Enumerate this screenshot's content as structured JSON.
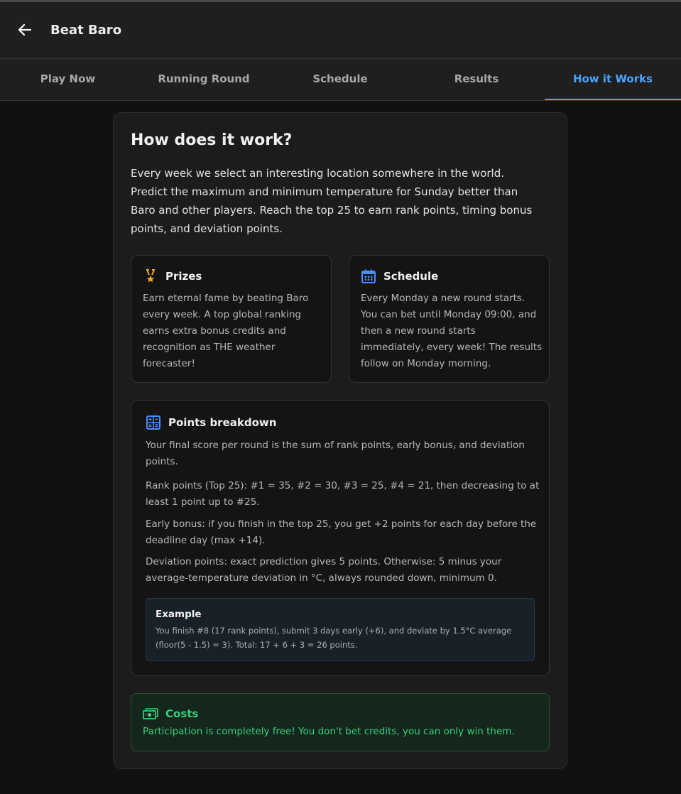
{
  "header": {
    "title": "Beat Baro",
    "back_icon": "arrow-left-icon"
  },
  "tabs": [
    {
      "label": "Play Now",
      "active": false
    },
    {
      "label": "Running Round",
      "active": false
    },
    {
      "label": "Schedule",
      "active": false
    },
    {
      "label": "Results",
      "active": false
    },
    {
      "label": "How it Works",
      "active": true
    }
  ],
  "colors": {
    "accent": "#4aa3ff",
    "prize_icon": "#f5a623",
    "schedule_icon": "#4a8cff",
    "points_icon": "#4a8cff",
    "costs_green": "#35d07a"
  },
  "main": {
    "title": "How does it work?",
    "intro_lines": [
      "Every week we select an interesting location somewhere in the world.",
      "Predict the maximum and minimum temperature for Sunday better than",
      "Baro and other players. Reach the top 25 to earn rank points, timing bonus",
      "points, and deviation points."
    ],
    "prizes": {
      "icon": "medal-icon",
      "title": "Prizes",
      "lines": [
        "Earn eternal fame by beating Baro",
        "every week. A top global ranking",
        "earns extra bonus credits and",
        "recognition as THE weather",
        "forecaster!"
      ]
    },
    "schedule": {
      "icon": "calendar-icon",
      "title": "Schedule",
      "lines": [
        "Every Monday a new round starts.",
        "You can bet until Monday 09:00, and",
        "then a new round starts",
        "immediately, every week! The results",
        "follow on Monday morning."
      ]
    },
    "points": {
      "icon": "calculator-icon",
      "title": "Points breakdown",
      "paragraphs": [
        [
          "Your final score per round is the sum of rank points, early bonus, and deviation",
          "points."
        ],
        [
          "Rank points (Top 25): #1 = 35, #2 = 30, #3 = 25, #4 = 21, then decreasing to at",
          "least 1 point up to #25."
        ],
        [
          "Early bonus: if you finish in the top 25, you get +2 points for each day before the",
          "deadline day (max +14)."
        ],
        [
          "Deviation points: exact prediction gives 5 points. Otherwise: 5 minus your",
          "average-temperature deviation in °C, always rounded down, minimum 0."
        ]
      ],
      "example": {
        "title": "Example",
        "lines": [
          "You finish #8 (17 rank points), submit 3 days early (+6), and deviate by 1.5°C average",
          "(floor(5 - 1.5) = 3). Total: 17 + 6 + 3 = 26 points."
        ]
      }
    },
    "costs": {
      "icon": "money-icon",
      "title": "Costs",
      "text": "Participation is completely free! You don't bet credits, you can only win them."
    }
  }
}
